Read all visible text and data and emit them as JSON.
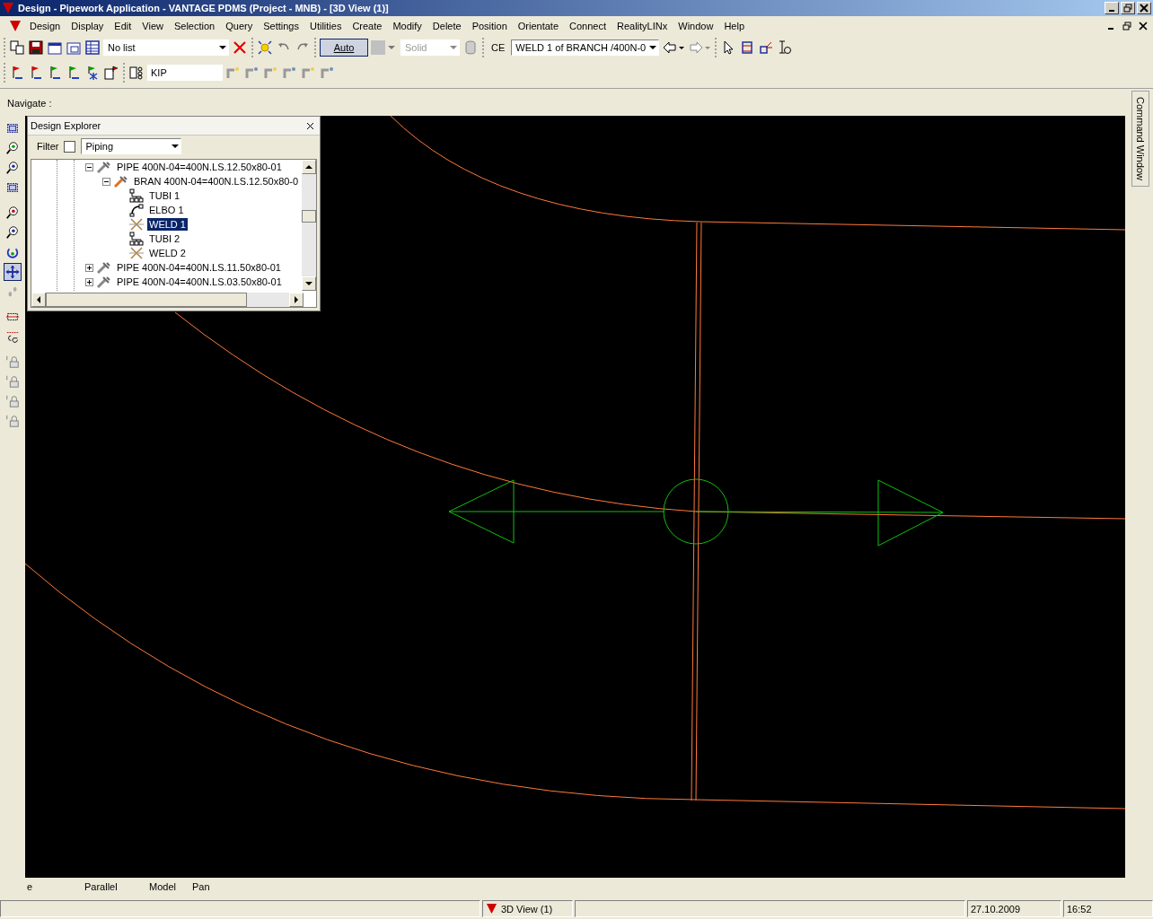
{
  "window": {
    "title": "Design - Pipework Application - VANTAGE PDMS (Project - MNB) - [3D View (1)]"
  },
  "menu": [
    "Design",
    "Display",
    "Edit",
    "View",
    "Selection",
    "Query",
    "Settings",
    "Utilities",
    "Create",
    "Modify",
    "Delete",
    "Position",
    "Orientate",
    "Connect",
    "RealityLINx",
    "Window",
    "Help"
  ],
  "toolbar": {
    "list_combo": {
      "value": "No list"
    },
    "auto_button": {
      "label": "Auto",
      "pressed": true
    },
    "render_combo": {
      "value": "Solid",
      "disabled": true
    },
    "ce_label": "CE",
    "ce_combo": {
      "value": "WELD 1 of BRANCH /400N-0"
    },
    "kip_field": {
      "value": "KIP"
    }
  },
  "navigate": {
    "label": "Navigate :"
  },
  "view_tools": [
    {
      "kind": "frame",
      "selected": false
    },
    {
      "kind": "zoom-green",
      "selected": false
    },
    {
      "kind": "zoom-doc",
      "selected": false
    },
    {
      "kind": "frame",
      "selected": false
    },
    {
      "kind": "zoom-red",
      "selected": false
    },
    {
      "kind": "zoom-in",
      "selected": false
    },
    {
      "kind": "rotate",
      "selected": false
    },
    {
      "kind": "pan",
      "selected": true
    },
    {
      "kind": "walk",
      "selected": false
    },
    {
      "kind": "clip",
      "selected": false
    },
    {
      "kind": "ce",
      "selected": false
    },
    {
      "kind": "lock",
      "selected": false
    },
    {
      "kind": "lock",
      "selected": false
    },
    {
      "kind": "lock",
      "selected": false
    },
    {
      "kind": "lock",
      "selected": false
    }
  ],
  "explorer": {
    "title": "Design Explorer",
    "filter_label": "Filter",
    "filter_checked": false,
    "filter_combo": {
      "value": "Piping"
    },
    "tree": [
      {
        "kind": "pipe",
        "label": "PIPE 400N-04=400N.LS.12.50x80-01",
        "expanded": true,
        "selected": false,
        "children": [
          {
            "kind": "branch",
            "label": "BRAN 400N-04=400N.LS.12.50x80-0",
            "expanded": true,
            "selected": false,
            "children": [
              {
                "kind": "tube",
                "label": "TUBI 1",
                "selected": false
              },
              {
                "kind": "elbow",
                "label": "ELBO 1",
                "selected": false
              },
              {
                "kind": "weld",
                "label": "WELD 1",
                "selected": true
              },
              {
                "kind": "tube",
                "label": "TUBI 2",
                "selected": false
              },
              {
                "kind": "weld",
                "label": "WELD 2",
                "selected": false
              }
            ]
          }
        ]
      },
      {
        "kind": "pipe",
        "label": "PIPE 400N-04=400N.LS.11.50x80-01",
        "expanded": false,
        "selected": false
      },
      {
        "kind": "pipe",
        "label": "PIPE 400N-04=400N.LS.03.50x80-01",
        "expanded": false,
        "selected": false
      }
    ]
  },
  "view_status": [
    "e",
    "Parallel",
    "Model",
    "Pan"
  ],
  "command_window": {
    "label": "Command Window"
  },
  "status_bar": {
    "view": "3D View (1)",
    "date": "27.10.2009",
    "time": "16:52"
  }
}
